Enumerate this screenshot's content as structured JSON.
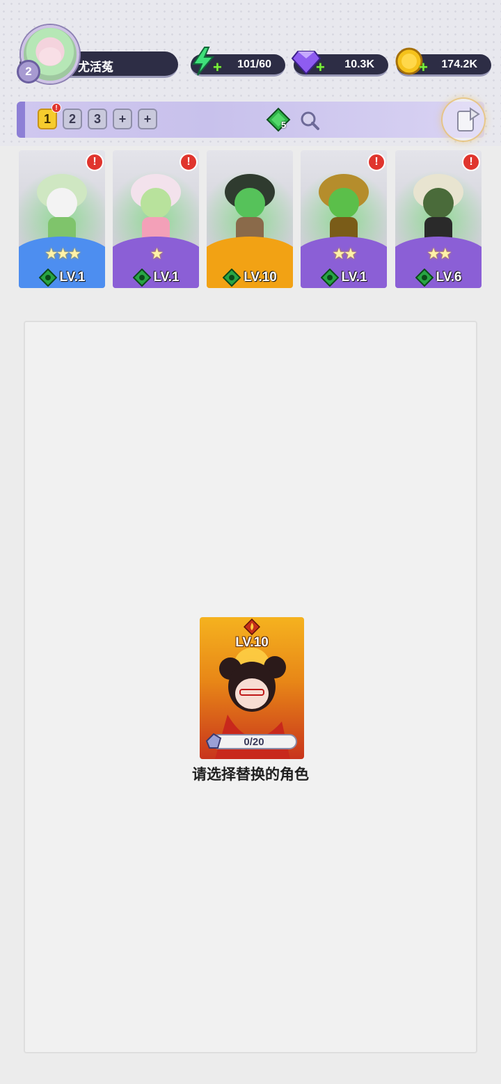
{
  "profile": {
    "name": "尤活菟",
    "level": "2"
  },
  "resources": {
    "energy": {
      "value": "101/60",
      "icon": "lightning-icon"
    },
    "diamonds": {
      "value": "10.3K",
      "icon": "diamond-icon"
    },
    "gold": {
      "value": "174.2K",
      "icon": "coin-icon"
    }
  },
  "team_bar": {
    "tabs": [
      "1",
      "2",
      "3",
      "+",
      "+"
    ],
    "active_tab": "1",
    "tab_alert": "!",
    "gem_count": "5"
  },
  "heroes": [
    {
      "level": "LV.1",
      "stars": "★★★",
      "alert": "!",
      "rarity_color": "#4d8ef0"
    },
    {
      "level": "LV.1",
      "stars": "★",
      "alert": "!",
      "rarity_color": "#8b5fd6"
    },
    {
      "level": "LV.10",
      "stars": "",
      "alert": "",
      "rarity_color": "#f2a214"
    },
    {
      "level": "LV.1",
      "stars": "★★",
      "alert": "!",
      "rarity_color": "#8b5fd6"
    },
    {
      "level": "LV.6",
      "stars": "★★",
      "alert": "!",
      "rarity_color": "#8b5fd6"
    }
  ],
  "selected_hero": {
    "level": "LV.10",
    "progress_text": "0/20",
    "progress": 0
  },
  "hint_text": "请选择替换的角色"
}
